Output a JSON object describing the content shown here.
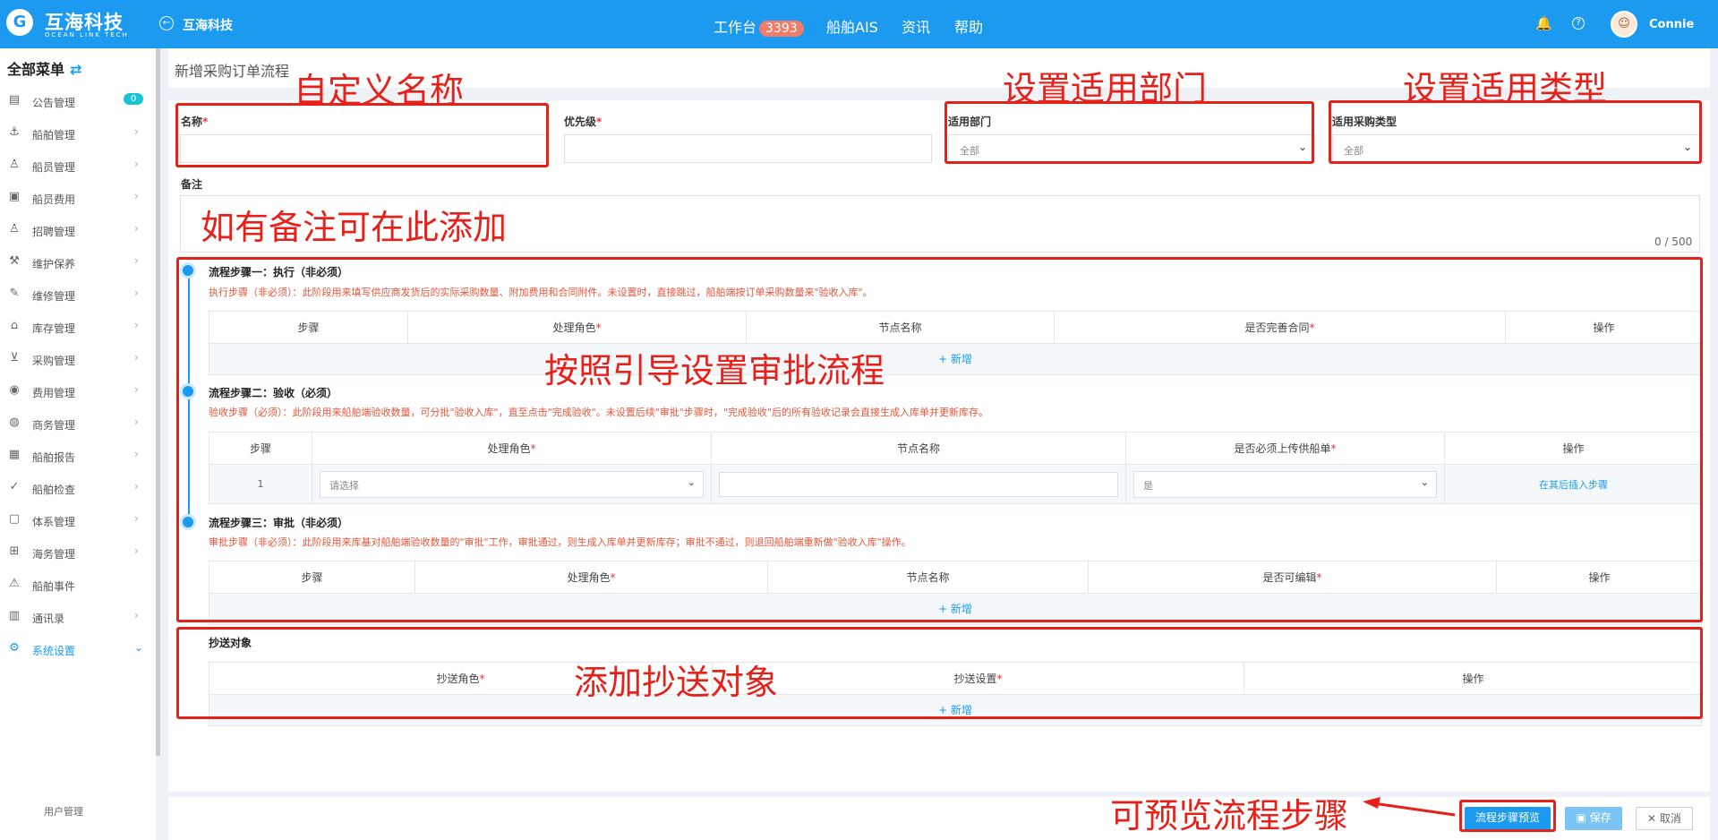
{
  "header": {
    "logo_char": "G",
    "brand": "互海科技",
    "brand_en": "OCEAN LINK TECH",
    "back_label": "互海科技",
    "nav": [
      {
        "label": "工作台",
        "badge": "3393"
      },
      {
        "label": "船舶AIS"
      },
      {
        "label": "资讯"
      },
      {
        "label": "帮助"
      }
    ],
    "user": "Connie"
  },
  "sidebar": {
    "title": "全部菜单",
    "items": [
      {
        "label": "公告管理",
        "icon": "notice-icon",
        "badge": "0"
      },
      {
        "label": "船舶管理",
        "icon": "anchor-icon"
      },
      {
        "label": "船员管理",
        "icon": "user-icon"
      },
      {
        "label": "船员费用",
        "icon": "wallet-icon"
      },
      {
        "label": "招聘管理",
        "icon": "recruit-icon"
      },
      {
        "label": "维护保养",
        "icon": "maintenance-icon"
      },
      {
        "label": "维修管理",
        "icon": "wrench-icon"
      },
      {
        "label": "库存管理",
        "icon": "warehouse-icon"
      },
      {
        "label": "采购管理",
        "icon": "cart-icon"
      },
      {
        "label": "费用管理",
        "icon": "coins-icon"
      },
      {
        "label": "商务管理",
        "icon": "globe-icon"
      },
      {
        "label": "船舶报告",
        "icon": "calendar-icon"
      },
      {
        "label": "船舶检查",
        "icon": "check-circle-icon"
      },
      {
        "label": "体系管理",
        "icon": "document-icon"
      },
      {
        "label": "海务管理",
        "icon": "signpost-icon"
      },
      {
        "label": "船舶事件",
        "icon": "warning-icon"
      },
      {
        "label": "通讯录",
        "icon": "contacts-icon"
      },
      {
        "label": "系统设置",
        "icon": "gear-icon"
      }
    ],
    "sub_item": "用户管理"
  },
  "page": {
    "title": "新增采购订单流程",
    "form": {
      "name_label": "名称",
      "priority_label": "优先级",
      "dept_label": "适用部门",
      "dept_value": "全部",
      "type_label": "适用采购类型",
      "type_value": "全部",
      "remark_label": "备注",
      "remark_count": "0 / 500"
    },
    "step1": {
      "title": "流程步骤一：执行（非必须）",
      "desc": "执行步骤（非必须）：此阶段用来填写供应商发货后的实际采购数量、附加费用和合同附件。未设置时，直接跳过，船舶端按订单采购数量来\"验收入库\"。",
      "columns": [
        "步骤",
        "处理角色",
        "节点名称",
        "是否完善合同",
        "操作"
      ],
      "add": "+ 新增"
    },
    "step2": {
      "title": "流程步骤二：验收（必须）",
      "desc": "验收步骤（必须）：此阶段用来船舶端验收数量，可分批\"验收入库\"，直至点击\"完成验收\"。未设置后续\"审批\"步骤时，\"完成验收\"后的所有验收记录会直接生成入库单并更新库存。",
      "columns": [
        "步骤",
        "处理角色",
        "节点名称",
        "是否必须上传供船单",
        "操作"
      ],
      "row": {
        "step": "1",
        "role_placeholder": "请选择",
        "upload_value": "是",
        "action": "在其后插入步骤"
      }
    },
    "step3": {
      "title": "流程步骤三：审批（非必须）",
      "desc": "审批步骤（非必须）：此阶段用来库基对船舶端验收数量的\"审批\"工作，审批通过，则生成入库单并更新库存；审批不通过，则退回船舶端重新做\"验收入库\"操作。",
      "columns": [
        "步骤",
        "处理角色",
        "节点名称",
        "是否可编辑",
        "操作"
      ],
      "add": "+ 新增"
    },
    "cc": {
      "title": "抄送对象",
      "columns": [
        "抄送角色",
        "抄送设置",
        "操作"
      ],
      "add": "+ 新增"
    }
  },
  "annotations": {
    "name": "自定义名称",
    "dept": "设置适用部门",
    "type": "设置适用类型",
    "remark": "如有备注可在此添加",
    "flow": "按照引导设置审批流程",
    "cc": "添加抄送对象",
    "preview": "可预览流程步骤"
  },
  "footer": {
    "preview": "流程步骤预览",
    "save": "保存",
    "cancel": "取消"
  },
  "colors": {
    "primary": "#1b9af0",
    "annotation": "#e5211a",
    "hint": "#e8553a"
  }
}
